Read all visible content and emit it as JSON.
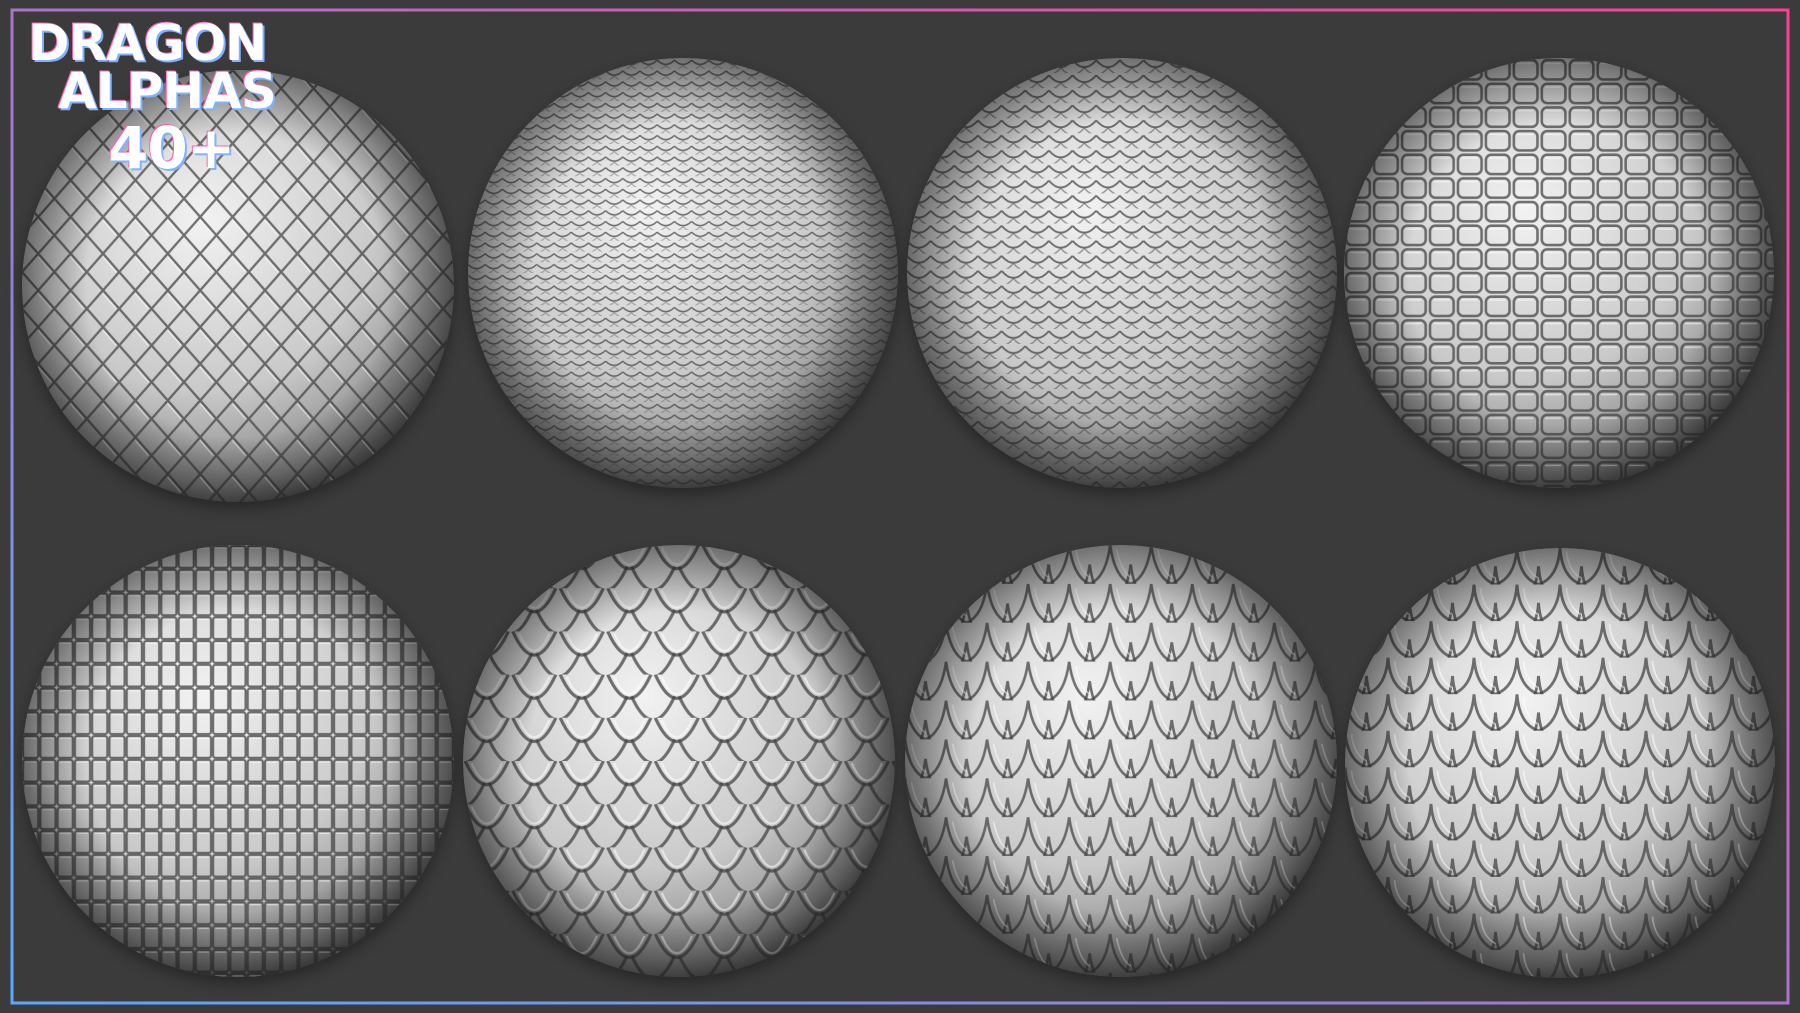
{
  "title": {
    "line1": "DRAGON",
    "line2": "ALPHAS",
    "line3": "40+"
  },
  "colors": {
    "background": "#3b3b3c",
    "frame_left": "#58a8ff",
    "frame_right": "#ff3e97",
    "sphere_light": "#f2f2f2",
    "sphere_dark": "#4a4a4a"
  },
  "spheres": [
    {
      "name": "diamond-scales-sphere",
      "pattern": "diamond"
    },
    {
      "name": "fine-row-scales-sphere",
      "pattern": "rows-fine"
    },
    {
      "name": "overlap-row-scales-sphere",
      "pattern": "rows"
    },
    {
      "name": "rough-plate-scales-sphere",
      "pattern": "plates"
    },
    {
      "name": "crocodile-grid-scales-sphere",
      "pattern": "grid"
    },
    {
      "name": "rounded-dragon-scales-sphere",
      "pattern": "round"
    },
    {
      "name": "pointed-dragon-scales-sphere",
      "pattern": "pointed"
    },
    {
      "name": "fish-dragon-scales-sphere",
      "pattern": "fish"
    }
  ]
}
